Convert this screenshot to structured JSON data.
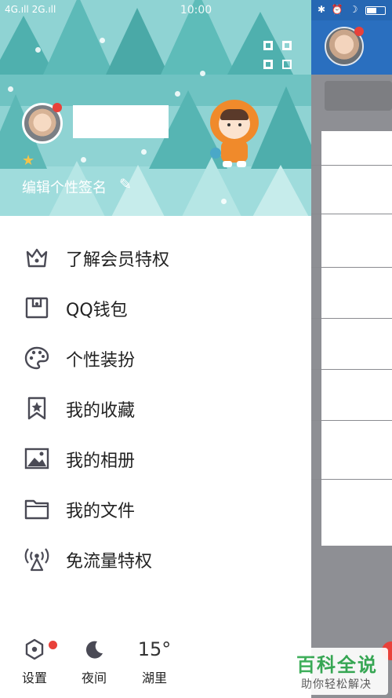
{
  "status_bar": {
    "time": "10:00",
    "signal": "4G.ıll 2G.ıll",
    "right_icons": "✱ ⏰ ☽"
  },
  "profile": {
    "signature_placeholder": "编辑个性签名"
  },
  "menu": {
    "items": [
      {
        "label": "了解会员特权",
        "icon": "crown-icon"
      },
      {
        "label": "QQ钱包",
        "icon": "wallet-icon"
      },
      {
        "label": "个性装扮",
        "icon": "palette-icon"
      },
      {
        "label": "我的收藏",
        "icon": "bookmark-star-icon"
      },
      {
        "label": "我的相册",
        "icon": "photo-icon"
      },
      {
        "label": "我的文件",
        "icon": "folder-icon"
      },
      {
        "label": "免流量特权",
        "icon": "antenna-icon"
      }
    ]
  },
  "footer": {
    "settings_label": "设置",
    "night_label": "夜间",
    "weather_temp": "15°",
    "weather_city": "湖里"
  },
  "watermark": {
    "title": "百科全说",
    "subtitle": "助你轻松解决"
  },
  "colors": {
    "header_teal": "#8fd3d3",
    "badge_red": "#e8413a",
    "accent_blue": "#2a6fbf",
    "watermark_green": "#2fa94e"
  }
}
